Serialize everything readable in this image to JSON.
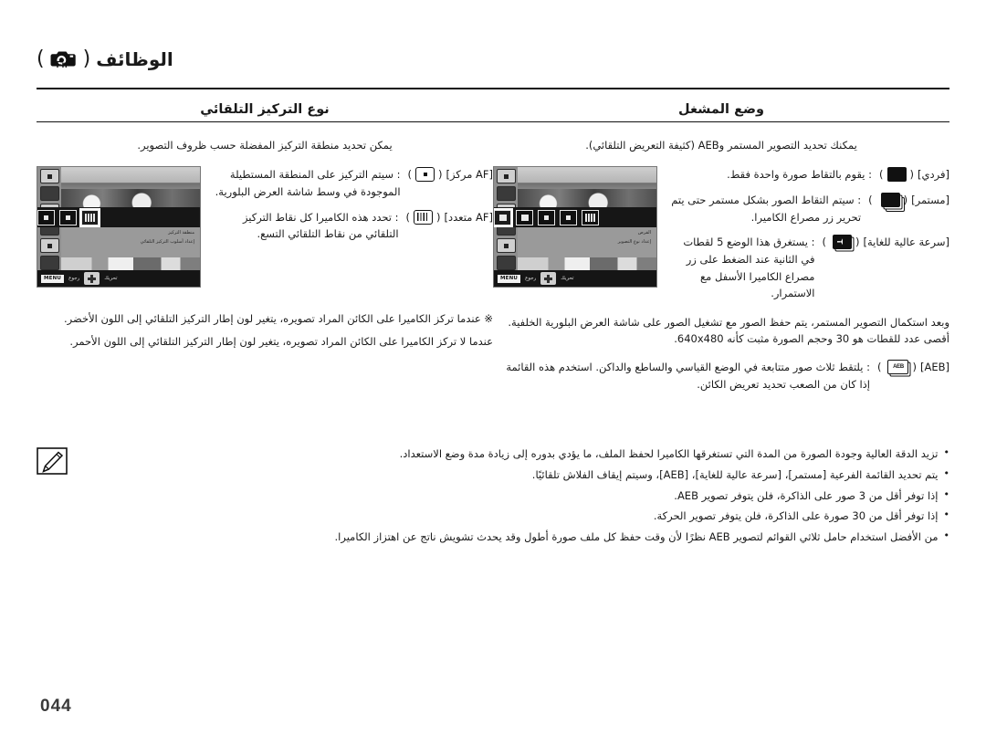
{
  "header": {
    "title": "الوظائف",
    "paren_open": "(",
    "paren_close": ")",
    "fn_icon_label": "Fn"
  },
  "columns": {
    "right": {
      "section_title": "وضع المشغل",
      "intro": "يمكنك تحديد التصوير المستمر وAEB (كثيفة التعريض التلقائي).",
      "lcd": {
        "menu_line1": "القرص",
        "menu_line2": "إعداد نوع التصوير",
        "menu_button": "MENU",
        "menu_back": "رجوع",
        "move_label": "تحريك"
      },
      "items": [
        {
          "key": "[فردي]",
          "icon": "single-shot-icon",
          "desc": ": يقوم بالتقاط صورة واحدة فقط."
        },
        {
          "key": "[مستمر]",
          "icon": "continuous-shot-icon",
          "desc": ": سيتم التقاط الصور بشكل مستمر حتى يتم تحرير زر مصراع الكاميرا."
        },
        {
          "key": "[سرعة عالية للغاية]",
          "icon": "high-speed-icon",
          "desc": ": يستغرق هذا الوضع 5 لقطات في الثانية عند الضغط على زر مصراع الكاميرا الأسفل مع الاستمرار."
        }
      ],
      "continuation": "وبعد استكمال التصوير المستمر، يتم حفظ الصور مع تشغيل الصور على شاشة العرض البلورية الخلفية. أقصى عدد للقطات هو 30 وحجم الصورة مثبت كأنه 640x480.",
      "aeb": {
        "key": "[AEB]",
        "icon": "aeb-icon",
        "desc": ": يلتقط ثلاث صور متتابعة في الوضع القياسي والساطع والداكن. استخدم هذه القائمة إذا كان من الصعب تحديد تعريض الكائن."
      }
    },
    "left": {
      "section_title": "نوع التركيز التلقائي",
      "intro": "يمكن تحديد منطقة التركيز المفضلة حسب ظروف التصوير.",
      "lcd": {
        "menu_line1": "منطقة التركيز",
        "menu_line2": "إعداد أسلوب التركيز التلقائي",
        "menu_button": "MENU",
        "menu_back": "رجوع",
        "move_label": "تحريك"
      },
      "items": [
        {
          "key": "[AF مركز]",
          "icon": "center-af-icon",
          "desc": ": سيتم التركيز على المنطقة المستطيلة الموجودة في وسط شاشة العرض البلورية."
        },
        {
          "key": "[AF متعدد]",
          "icon": "multi-af-icon",
          "desc": ": تحدد هذه الكاميرا كل نقاط التركيز التلقائي من نقاط التلقائي التسع."
        }
      ],
      "star_notes": [
        "※ عندما تركز الكاميرا على الكائن المراد تصويره، يتغير لون إطار التركيز التلقائي إلى اللون الأخضر.",
        "عندما لا تركز الكاميرا على الكائن المراد تصويره، يتغير لون إطار التركيز التلقائي إلى اللون الأحمر."
      ]
    }
  },
  "notes": {
    "icon": "note-pencil-icon",
    "bullet": "•",
    "items": [
      "تزيد الدقة العالية وجودة الصورة من المدة التي تستغرقها الكاميرا لحفظ الملف، ما يؤدي بدوره إلى زيادة مدة وضع الاستعداد.",
      "يتم تحديد القائمة الفرعية [مستمر]، [سرعة عالية للغاية]، [AEB]، وسيتم إيقاف الفلاش تلقائيًا.",
      "إذا توفر أقل من 3 صور على الذاكرة، فلن يتوفر تصوير AEB.",
      "إذا توفر أقل من 30 صورة على الذاكرة، فلن يتوفر تصوير الحركة.",
      "من الأفضل استخدام حامل ثلاثي القوائم لتصوير AEB نظرًا لأن وقت حفظ كل ملف صورة أطول وقد يحدث تشويش ناتج عن اهتزاز الكاميرا."
    ]
  },
  "footer": {
    "page_number": "044"
  }
}
